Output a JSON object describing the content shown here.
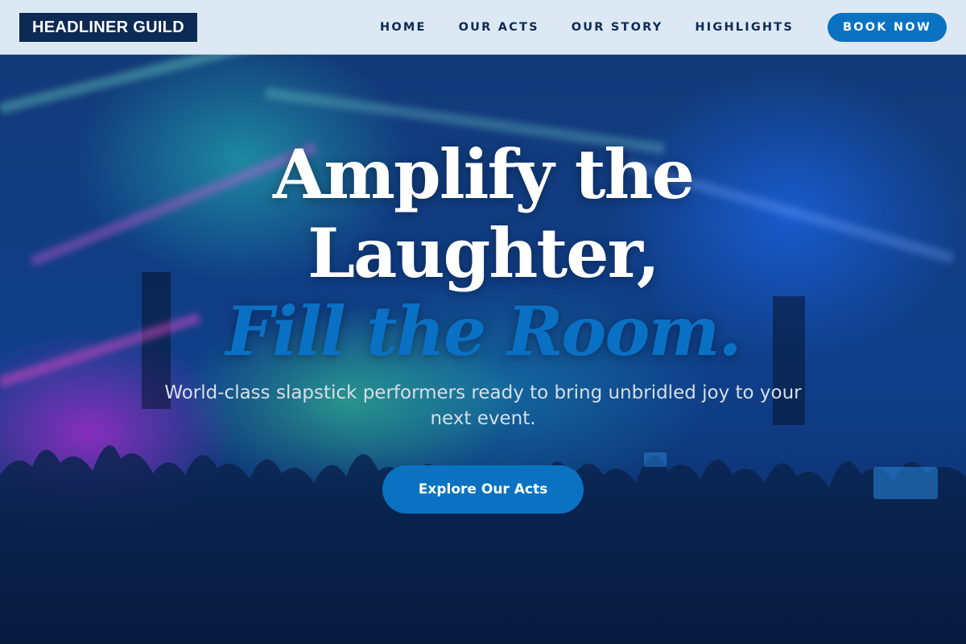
{
  "brand": {
    "name": "HEADLINER GUILD"
  },
  "nav": {
    "items": [
      {
        "label": "HOME"
      },
      {
        "label": "OUR ACTS"
      },
      {
        "label": "OUR STORY"
      },
      {
        "label": "HIGHLIGHTS"
      }
    ],
    "cta_label": "BOOK NOW"
  },
  "hero": {
    "headline_line1": "Amplify the",
    "headline_line2": "Laughter,",
    "headline_line3": "Fill the Room.",
    "subtitle": "World-class slapstick performers ready to bring unbridled joy to your next event.",
    "cta_label": "Explore Our Acts",
    "background_image": "concert-crowd-stage-lights-image"
  },
  "colors": {
    "header_bg": "#dce8f3",
    "navy": "#0c2a54",
    "accent_blue": "#0a72c0",
    "hero_overlay": "#0f3f8a"
  }
}
